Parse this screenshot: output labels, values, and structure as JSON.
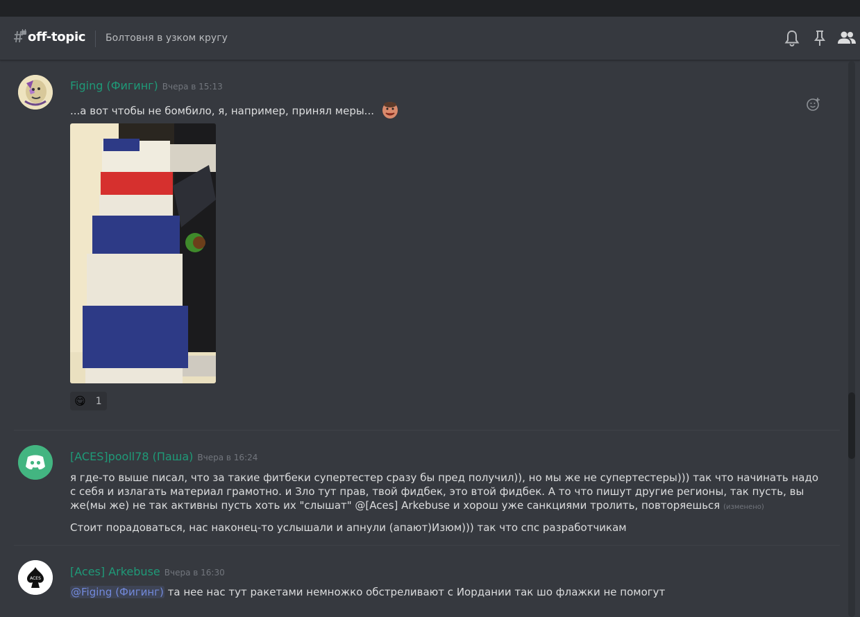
{
  "channel": {
    "name": "off-topic",
    "topic": "Болтовня в узком кругу"
  },
  "header_icons": [
    "bell-icon",
    "pin-icon",
    "members-icon"
  ],
  "messages": [
    {
      "author": "Figing (Фигинг)",
      "timestamp": "Вчера в 15:13",
      "text": "...а вот чтобы не бомбило, я, например, принял меры...",
      "reaction": {
        "emoji": "😋",
        "count": "1"
      }
    },
    {
      "author": "[ACES]pooll78 (Паша)",
      "timestamp": "Вчера в 16:24",
      "text_part1": "я где-то выше писал, что за такие фитбеки супертестер сразу бы пред получил)), но мы же не супертестеры))) так что начинать надо с себя и излагать материал грамотно. и Зло тут прав, твой фидбек, это втой фидбек. А то что пишут другие регионы, так пусть, вы же(мы же) не так активны пусть хоть их \"слышат\" @[Aces] Arkebuse и хорош уже санкциями тролить, повторяешься",
      "edited": "(изменено)",
      "text_part2": "Стоит порадоваться, нас наконец-то услышали и апнули (апают)Изюм))) так что спс разработчикам"
    },
    {
      "author": "[Aces] Arkebuse",
      "timestamp": "Вчера в 16:30",
      "mention": "@Figing (Фигинг)",
      "text": "та нее нас тут ракетами немножко обстреливают с Иордании  так шо флажки не помогут"
    }
  ],
  "colors": {
    "background": "#36393f",
    "username": "#1f9a78",
    "text": "#dcddde",
    "timestamp": "#72767d",
    "mention": "#7289da"
  }
}
